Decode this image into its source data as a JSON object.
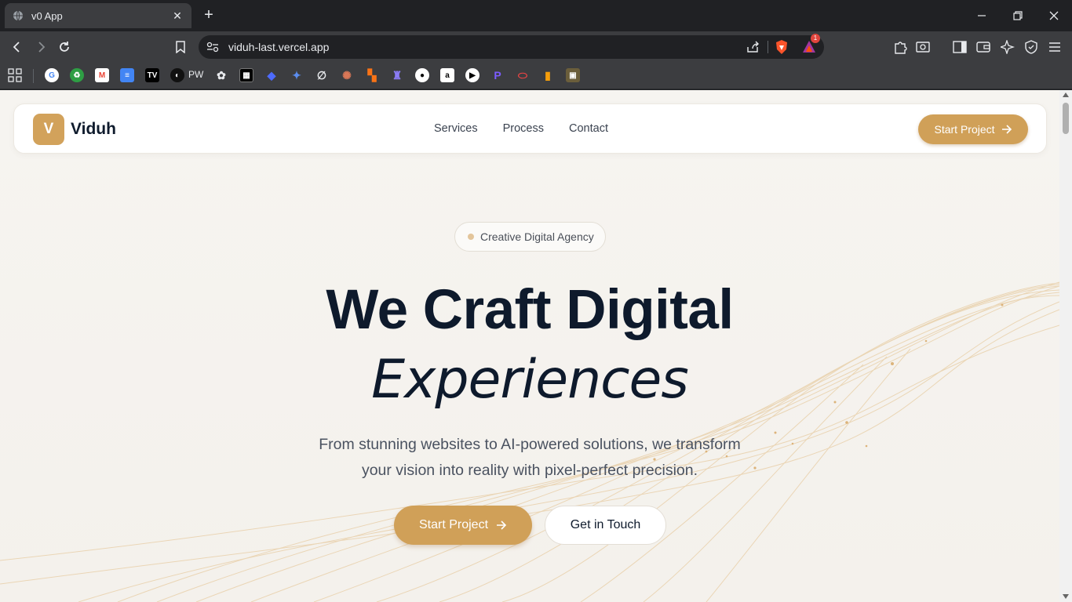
{
  "browser": {
    "tab_title": "v0 App",
    "new_tab_label": "+",
    "url": "viduh-last.vercel.app",
    "notification_count": "1",
    "bookmark_text": "PW"
  },
  "site": {
    "logo_letter": "V",
    "logo_name": "Viduh",
    "nav_links": [
      "Services",
      "Process",
      "Contact"
    ],
    "nav_cta": "Start Project",
    "accent_color": "#d0a058"
  },
  "hero": {
    "badge": "Creative Digital Agency",
    "title_line1": "We Craft Digital",
    "title_line2": "Experiences",
    "lead_line1": "From stunning websites to AI-powered solutions, we transform",
    "lead_line2": "your vision into reality with pixel-perfect precision.",
    "primary_cta": "Start Project",
    "secondary_cta": "Get in Touch"
  }
}
